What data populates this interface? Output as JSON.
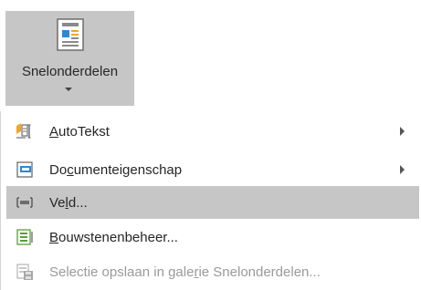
{
  "ribbon": {
    "button_label": "Snelonderdelen",
    "icon": "quick-parts-icon"
  },
  "menu": {
    "items": [
      {
        "pre": "",
        "key": "A",
        "post": "utoTekst",
        "icon": "autotext-icon",
        "has_submenu": true,
        "state": "normal"
      },
      {
        "pre": "Do",
        "key": "c",
        "post": "umenteigenschap",
        "icon": "document-property-icon",
        "has_submenu": true,
        "state": "normal"
      },
      {
        "pre": "Ve",
        "key": "l",
        "post": "d...",
        "icon": "field-icon",
        "has_submenu": false,
        "state": "highlighted"
      },
      {
        "pre": "",
        "key": "B",
        "post": "ouwstenenbeheer...",
        "icon": "building-blocks-organizer-icon",
        "has_submenu": false,
        "state": "normal"
      },
      {
        "pre": "Selectie opslaan in gale",
        "key": "r",
        "post": "ie Snelonderdelen...",
        "icon": "save-to-gallery-icon",
        "has_submenu": false,
        "state": "disabled"
      }
    ]
  }
}
